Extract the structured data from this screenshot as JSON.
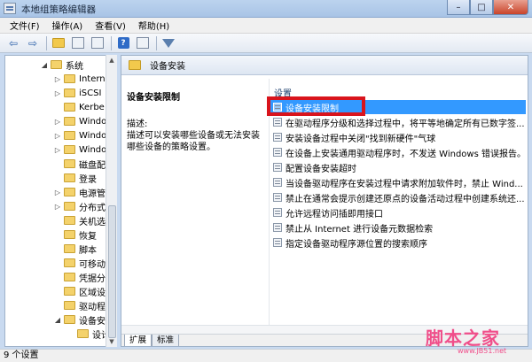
{
  "window": {
    "title": "本地组策略编辑器"
  },
  "menubar": {
    "items": [
      "文件(F)",
      "操作(A)",
      "查看(V)",
      "帮助(H)"
    ]
  },
  "tree": {
    "items": [
      {
        "label": "系统",
        "arrow": "◢"
      },
      {
        "label": "Intern",
        "arrow": "▷"
      },
      {
        "label": "iSCSI",
        "arrow": "▷"
      },
      {
        "label": "Kerbe",
        "arrow": ""
      },
      {
        "label": "Windo",
        "arrow": "▷"
      },
      {
        "label": "Windo",
        "arrow": "▷"
      },
      {
        "label": "Windo",
        "arrow": "▷"
      },
      {
        "label": "磁盘配",
        "arrow": ""
      },
      {
        "label": "登录",
        "arrow": ""
      },
      {
        "label": "电源管",
        "arrow": "▷"
      },
      {
        "label": "分布式",
        "arrow": "▷"
      },
      {
        "label": "关机选",
        "arrow": ""
      },
      {
        "label": "恢复",
        "arrow": ""
      },
      {
        "label": "脚本",
        "arrow": ""
      },
      {
        "label": "可移动",
        "arrow": ""
      },
      {
        "label": "凭据分",
        "arrow": ""
      },
      {
        "label": "区域设",
        "arrow": ""
      },
      {
        "label": "驱动程",
        "arrow": ""
      },
      {
        "label": "设备安",
        "arrow": "◢"
      },
      {
        "label": "设计",
        "arrow": ""
      }
    ]
  },
  "right_pane": {
    "header_title": "设备安装",
    "description_title": "设备安装限制",
    "description_label": "描述:",
    "description_text": "描述可以安装哪些设备或无法安装哪些设备的策略设置。",
    "column_header": "设置",
    "settings": [
      "设备安装限制",
      "在驱动程序分级和选择过程中，将平等地确定所有已数字签...",
      "安装设备过程中关闭\"找到新硬件\"气球",
      "在设备上安装通用驱动程序时，不发送 Windows 错误报告。",
      "配置设备安装超时",
      "当设备驱动程序在安装过程中请求附加软件时，禁止 Wind...",
      "禁止在通常会提示创建还原点的设备活动过程中创建系统还...",
      "允许远程访问插即用接口",
      "禁止从 Internet 进行设备元数据检索",
      "指定设备驱动程序源位置的搜索顺序"
    ],
    "tabs": [
      "扩展",
      "标准"
    ]
  },
  "statusbar": {
    "text": "9 个设置"
  },
  "watermark": {
    "logo": "脚本之家",
    "url": "www.JB51.net"
  }
}
